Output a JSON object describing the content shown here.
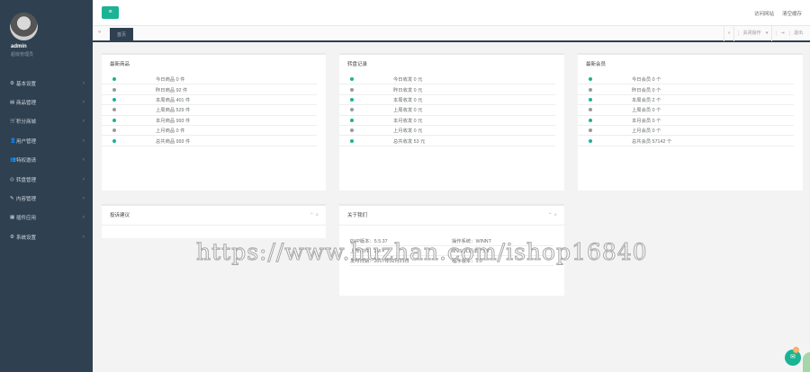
{
  "user": {
    "name": "admin",
    "role": "超级管理员"
  },
  "sidebar": {
    "items": [
      {
        "label": "基本设置",
        "icon": "gear-icon",
        "glyph": "⚙"
      },
      {
        "label": "商品管理",
        "icon": "list-icon",
        "glyph": "▤"
      },
      {
        "label": "积分商城",
        "icon": "cart-icon",
        "glyph": "🛒"
      },
      {
        "label": "用户管理",
        "icon": "user-icon",
        "glyph": "👤"
      },
      {
        "label": "特权邀请",
        "icon": "users-icon",
        "glyph": "👥"
      },
      {
        "label": "转盘管理",
        "icon": "circle-icon",
        "glyph": "◎"
      },
      {
        "label": "内容管理",
        "icon": "edit-icon",
        "glyph": "✎"
      },
      {
        "label": "插件应用",
        "icon": "grid-icon",
        "glyph": "▦"
      },
      {
        "label": "系统设置",
        "icon": "cogs-icon",
        "glyph": "⚙"
      }
    ]
  },
  "topbar": {
    "visit_site": "访问网站",
    "clear_cache": "清空缓存"
  },
  "tabs": {
    "active": "首页",
    "ops": "关闭操作",
    "exit": "退出"
  },
  "cards": {
    "goods": {
      "title": "最新商品",
      "rows": [
        {
          "label": "今日商品 0 件",
          "color": "#1ab394"
        },
        {
          "label": "昨日商品 92 件",
          "color": "#9a9a9a"
        },
        {
          "label": "本周商品 401 件",
          "color": "#1ab394"
        },
        {
          "label": "上周商品 529 件",
          "color": "#9a9a9a"
        },
        {
          "label": "本月商品 993 件",
          "color": "#1ab394"
        },
        {
          "label": "上月商品 0 件",
          "color": "#9a9a9a"
        },
        {
          "label": "总共商品 993 件",
          "color": "#1ab394"
        }
      ]
    },
    "withdraw": {
      "title": "转盘记录",
      "rows": [
        {
          "label": "今日收发 0 元",
          "color": "#1ab394"
        },
        {
          "label": "昨日收发 0 元",
          "color": "#9a9a9a"
        },
        {
          "label": "本周收发 0 元",
          "color": "#1ab394"
        },
        {
          "label": "上周收发 0 元",
          "color": "#9a9a9a"
        },
        {
          "label": "本月收发 0 元",
          "color": "#1ab394"
        },
        {
          "label": "上月收发 0 元",
          "color": "#9a9a9a"
        },
        {
          "label": "总共收发 53 元",
          "color": "#1ab394"
        }
      ]
    },
    "members": {
      "title": "最新会员",
      "rows": [
        {
          "label": "今日会员 0 个",
          "color": "#1ab394"
        },
        {
          "label": "昨日会员 0 个",
          "color": "#9a9a9a"
        },
        {
          "label": "本周会员 2 个",
          "color": "#1ab394"
        },
        {
          "label": "上周会员 0 个",
          "color": "#9a9a9a"
        },
        {
          "label": "本月会员 0 个",
          "color": "#1ab394"
        },
        {
          "label": "上月会员 0 个",
          "color": "#9a9a9a"
        },
        {
          "label": "总共会员 57142 个",
          "color": "#1ab394"
        }
      ]
    },
    "feedback": {
      "title": "投诉建议"
    },
    "about": {
      "title": "关于我们",
      "rows": [
        [
          "PHP版本：5.5.37",
          "操作系统：WINNT"
        ],
        [
          "上传附件：2M",
          "MYSQL版本：5.x"
        ],
        [
          "发布日期：2017年02月21日",
          "程序版本：1.0"
        ]
      ]
    }
  },
  "watermark": "https://www.huzhan.com/ishop16840",
  "chat": {
    "badge": "0"
  }
}
